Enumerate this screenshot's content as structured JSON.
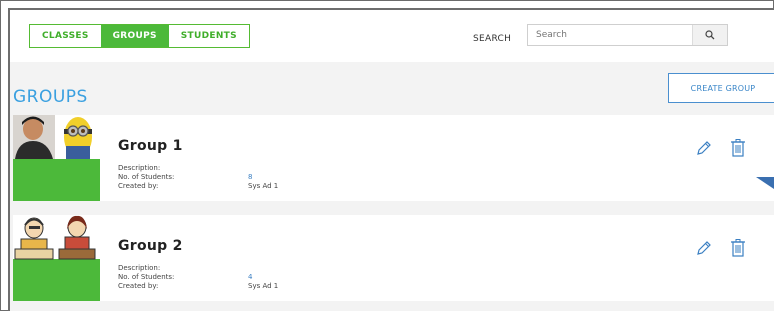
{
  "tabs": [
    {
      "label": "CLASSES"
    },
    {
      "label": "GROUPS"
    },
    {
      "label": "STUDENTS"
    }
  ],
  "search": {
    "label": "SEARCH",
    "placeholder": "Search",
    "icon": "search-icon"
  },
  "page_title": "GROUPS",
  "create_button": "CREATE GROUP",
  "field_labels": {
    "description": "Description:",
    "count": "No. of Students:",
    "created_by": "Created by:"
  },
  "groups": [
    {
      "name": "Group 1",
      "description": "",
      "count": "8",
      "created_by": "Sys Ad 1"
    },
    {
      "name": "Group 2",
      "description": "",
      "count": "4",
      "created_by": "Sys Ad 1"
    }
  ],
  "colors": {
    "accent_green": "#4cb93a",
    "accent_blue": "#3aa0e0"
  }
}
